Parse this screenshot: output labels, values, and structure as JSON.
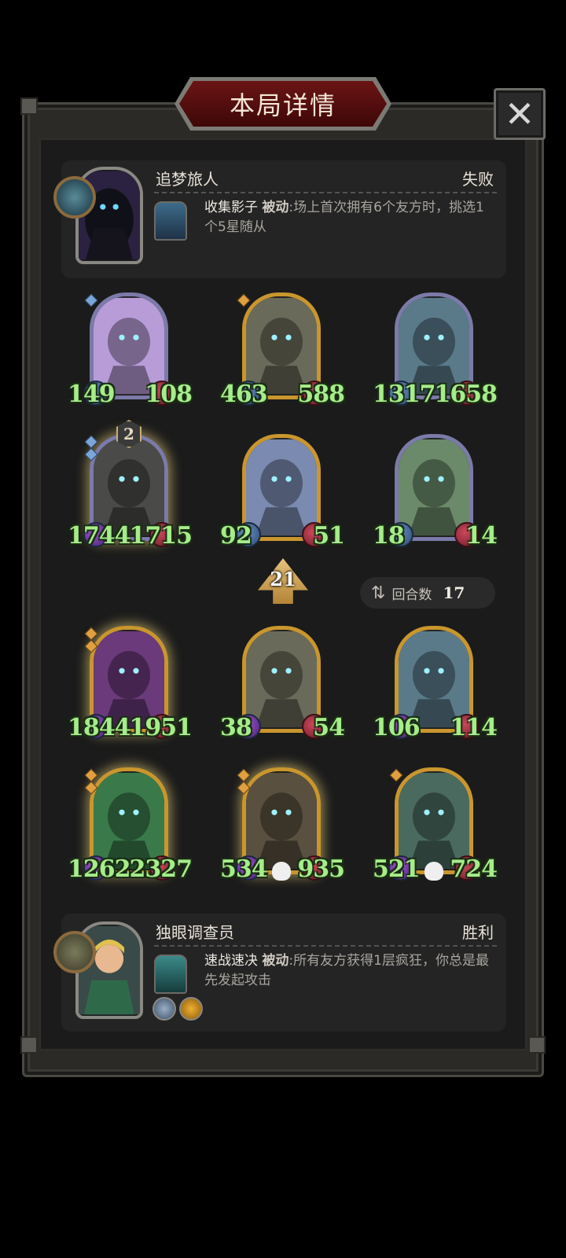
{
  "title": "本局详情",
  "close_icon": "✕",
  "top_player": {
    "name": "追梦旅人",
    "result": "失败",
    "skill_name": "收集影子",
    "skill_type": "被动",
    "skill_text": ":场上首次拥有6个友方时，挑选1个5星随从"
  },
  "bottom_player": {
    "name": "独眼调查员",
    "result": "胜利",
    "skill_name": "速战速决",
    "skill_type": "被动",
    "skill_text": ":所有友方获得1层疯狂，你总是最先发起攻击"
  },
  "top_board": [
    {
      "atk": "149",
      "hp": "108"
    },
    {
      "atk": "463",
      "hp": "588"
    },
    {
      "atk": "1317",
      "hp": "1658"
    },
    {
      "atk": "1744",
      "hp": "1715",
      "level": "2"
    },
    {
      "atk": "92",
      "hp": "51"
    },
    {
      "atk": "18",
      "hp": "14"
    }
  ],
  "tier": "21",
  "round": {
    "label": "回合数",
    "value": "17"
  },
  "bottom_board": [
    {
      "atk": "1844",
      "hp": "1951"
    },
    {
      "atk": "38",
      "hp": "54"
    },
    {
      "atk": "106",
      "hp": "114"
    },
    {
      "atk": "1262",
      "hp": "2327"
    },
    {
      "atk": "534",
      "hp": "935"
    },
    {
      "atk": "521",
      "hp": "724"
    }
  ],
  "colors": {
    "stat_green": "#a6ec8a",
    "gold_frame": "#c9962e",
    "silver_frame": "#7b7aa8",
    "title_red": "#6b1414"
  }
}
